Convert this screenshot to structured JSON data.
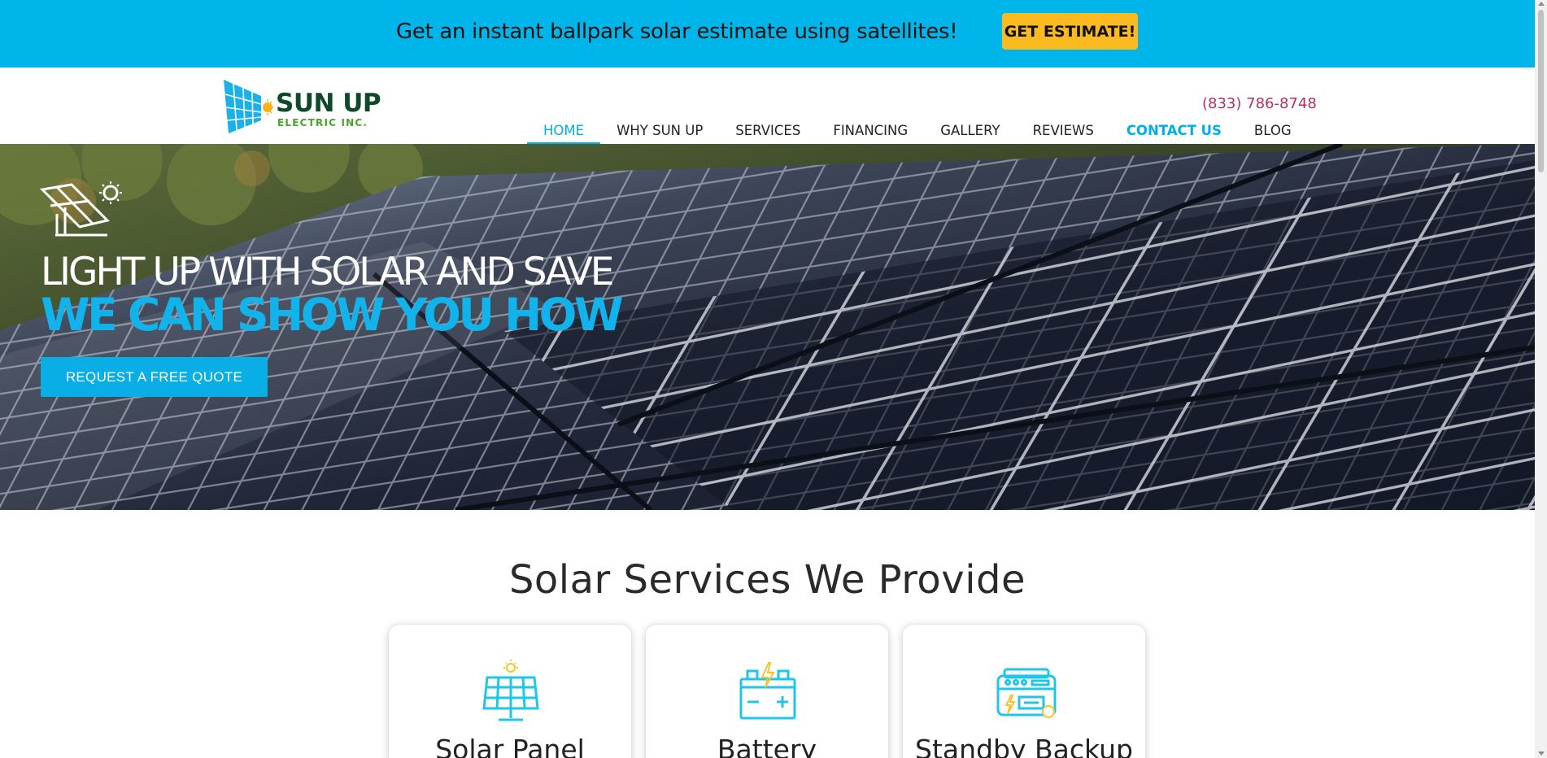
{
  "banner": {
    "text": "Get an instant ballpark solar estimate using satellites!",
    "button_label": "GET ESTIMATE!"
  },
  "header": {
    "logo": {
      "name": "SUN UP",
      "sub": "ELECTRIC INC."
    },
    "phone": "(833) 786-8748",
    "nav": [
      {
        "label": "HOME",
        "active": true
      },
      {
        "label": "WHY SUN UP"
      },
      {
        "label": "SERVICES"
      },
      {
        "label": "FINANCING"
      },
      {
        "label": "GALLERY"
      },
      {
        "label": "REVIEWS"
      },
      {
        "label": "CONTACT US",
        "highlight": true
      },
      {
        "label": "BLOG"
      }
    ]
  },
  "hero": {
    "line1": "LIGHT UP WITH SOLAR AND SAVE",
    "line2": "WE CAN SHOW YOU HOW",
    "button_label": "REQUEST A FREE QUOTE"
  },
  "services": {
    "title": "Solar Services We Provide",
    "cards": [
      {
        "title": "Solar Panel",
        "icon": "solar-panel-icon"
      },
      {
        "title": "Battery",
        "icon": "battery-icon"
      },
      {
        "title": "Standby Backup",
        "icon": "generator-icon"
      }
    ]
  },
  "colors": {
    "banner_bg": "#00b5ea",
    "accent": "#00aee6",
    "cta_yellow": "#fbba1f",
    "phone": "#b3325d",
    "logo_green": "#0e4a2a"
  }
}
